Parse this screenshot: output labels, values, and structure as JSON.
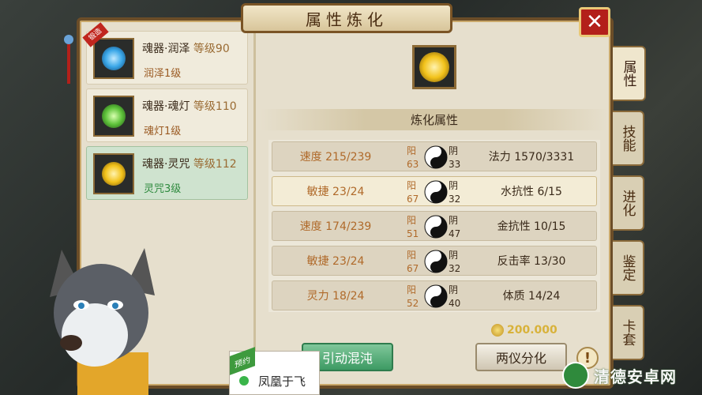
{
  "title": "属性炼化",
  "close_label": "✕",
  "items": [
    {
      "name": "魂器·润泽",
      "level": "等级90",
      "sub": "润泽1级",
      "glow": "#3aa7e8"
    },
    {
      "name": "魂器·魂灯",
      "level": "等级110",
      "sub": "魂灯1级",
      "glow": "#5ec23a"
    },
    {
      "name": "魂器·灵咒",
      "level": "等级112",
      "sub": "灵咒3级",
      "glow": "#f2c21a"
    }
  ],
  "ribbon_label": "锻造",
  "tabs": [
    "属性",
    "技能",
    "进化",
    "鉴定",
    "卡套"
  ],
  "section_title": "炼化属性",
  "yin_label": "阳",
  "yang_label": "阴",
  "rows": [
    {
      "left": "速度 215/239",
      "yin": "63",
      "yang": "33",
      "right": "法力 1570/3331"
    },
    {
      "left": "敏捷 23/24",
      "yin": "67",
      "yang": "32",
      "right": "水抗性 6/15"
    },
    {
      "left": "速度 174/239",
      "yin": "51",
      "yang": "47",
      "right": "金抗性 10/15"
    },
    {
      "left": "敏捷 23/24",
      "yin": "67",
      "yang": "32",
      "right": "反击率 13/30"
    },
    {
      "left": "灵力 18/24",
      "yin": "52",
      "yang": "40",
      "right": "体质 14/24"
    }
  ],
  "cost": "200.000",
  "btn_left": "引动混沌",
  "btn_right": "两仪分化",
  "warn": "!",
  "reserve": {
    "tag": "预约",
    "text": "凤凰于飞"
  },
  "watermark": "清德安卓网",
  "colors": {
    "accent_green": "#3d9a63",
    "close_red": "#b3201a",
    "frame": "#6b4d28"
  }
}
